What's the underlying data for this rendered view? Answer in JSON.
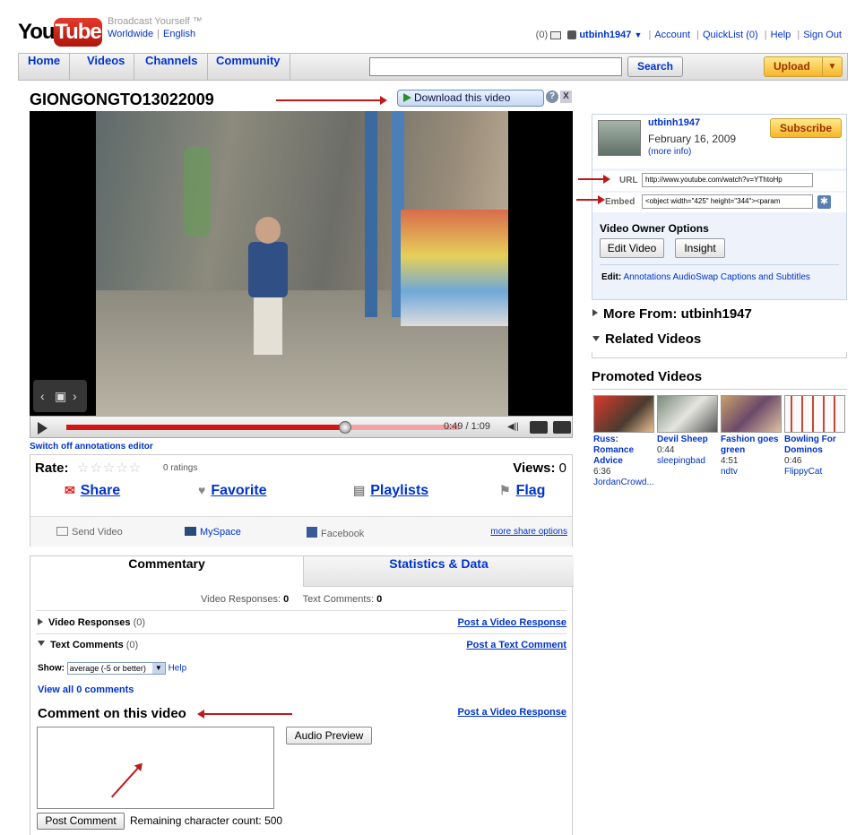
{
  "header": {
    "logo_you": "You",
    "logo_tube": "Tube",
    "tagline": "Broadcast Yourself ™",
    "region": "Worldwide",
    "language": "English",
    "mail_count": "(0)",
    "username": "utbinh1947",
    "account": "Account",
    "quicklist": "QuickList (0)",
    "help": "Help",
    "sign_out": "Sign Out"
  },
  "nav": {
    "tabs": [
      "Home",
      "Videos",
      "Channels",
      "Community"
    ],
    "search_button": "Search",
    "search_value": "",
    "upload_button": "Upload"
  },
  "video": {
    "title": "GIONGONGTO13022009",
    "download_button": "Download this video",
    "help_glyph": "?",
    "close_glyph": "X",
    "time": "0:49 / 1:09",
    "progress": 0.71,
    "annotations_link": "Switch off annotations editor"
  },
  "rating": {
    "label": "Rate:",
    "stars": "☆☆☆☆☆",
    "ratings_text": "0 ratings",
    "views_label": "Views:",
    "views_value": "0"
  },
  "actions": {
    "share": "Share",
    "favorite": "Favorite",
    "playlists": "Playlists",
    "flag": "Flag"
  },
  "share_row": {
    "send_video": "Send Video",
    "myspace": "MySpace",
    "facebook": "Facebook",
    "more": "more share options"
  },
  "comments": {
    "tab_commentary": "Commentary",
    "tab_stats": "Statistics & Data",
    "video_responses_label": "Video Responses:",
    "video_responses_count": "0",
    "text_comments_label": "Text Comments:",
    "text_comments_count": "0",
    "section_video_responses": "Video Responses",
    "section_video_responses_count": "(0)",
    "post_video_response": "Post a Video Response",
    "section_text_comments": "Text Comments",
    "section_text_comments_count": "(0)",
    "post_text_comment": "Post a Text Comment",
    "show_label": "Show:",
    "show_value": "average (-5 or better)",
    "help": "Help",
    "view_all": "View all 0 comments",
    "comment_heading": "Comment on this video",
    "post_video_response_2": "Post a Video Response",
    "audio_preview": "Audio Preview",
    "post_comment": "Post Comment",
    "remaining": "Remaining character count: 500"
  },
  "owner": {
    "name": "utbinh1947",
    "date": "February 16, 2009",
    "more_info": "(more info)",
    "subscribe": "Subscribe",
    "url_label": "URL",
    "url_value": "http://www.youtube.com/watch?v=YThtoHp",
    "embed_label": "Embed",
    "embed_value": "<object width=\"425\" height=\"344\"><param",
    "options_title": "Video Owner Options",
    "edit_video": "Edit Video",
    "insight": "Insight",
    "edit_label": "Edit:",
    "edit_links": "Annotations   AudioSwap   Captions and Subtitles"
  },
  "sidebar": {
    "more_from": "More From: utbinh1947",
    "related": "Related Videos",
    "promoted": "Promoted Videos",
    "promoted_videos": [
      {
        "title": "Russ: Romance Advice",
        "duration": "6:36",
        "user": "JordanCrowd..."
      },
      {
        "title": "Devil Sheep",
        "duration": "0:44",
        "user": "sleepingbad"
      },
      {
        "title": "Fashion goes green",
        "duration": "4:51",
        "user": "ndtv"
      },
      {
        "title": "Bowling For Dominos",
        "duration": "0:46",
        "user": "FlippyCat"
      }
    ]
  },
  "colors": {
    "link": "#0033cc",
    "annotation_arrow": "#c0191b",
    "progress_red": "#d51515",
    "upload_yellow": "#f7b52a"
  }
}
